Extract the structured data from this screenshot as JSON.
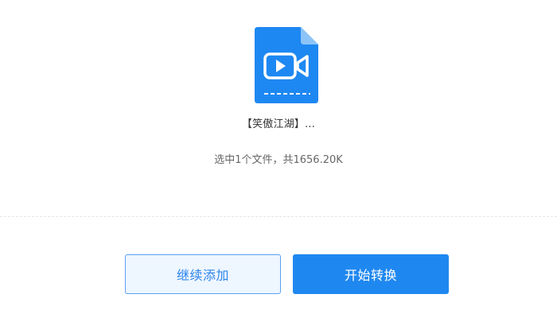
{
  "file": {
    "name": "【笑傲江湖】...",
    "icon": "video-file-icon",
    "icon_color": "#1e88f2"
  },
  "summary": {
    "text": "选中1个文件，共1656.20K"
  },
  "buttons": {
    "continue_label": "继续添加",
    "start_label": "开始转换"
  },
  "colors": {
    "accent": "#1f88f0",
    "secondary_bg": "#eef6ff",
    "secondary_border": "#5aa0ef"
  }
}
